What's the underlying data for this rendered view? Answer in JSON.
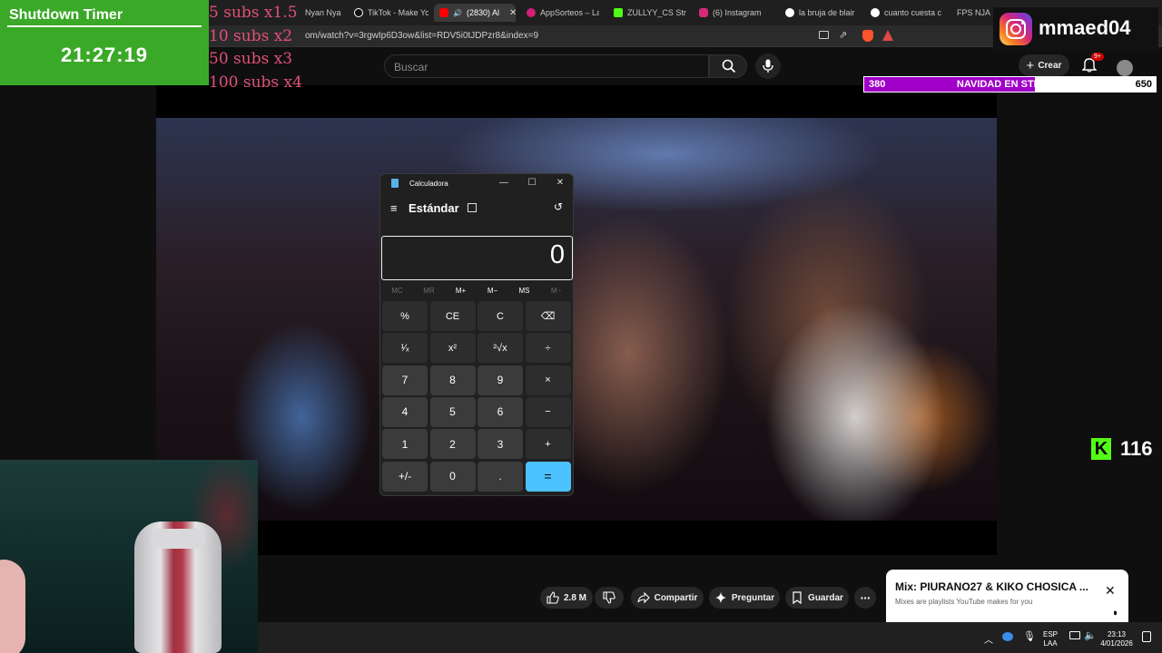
{
  "browser": {
    "tabs": [
      {
        "label": "Nyan Nya",
        "color": "#888888"
      },
      {
        "label": "TikTok - Make Yo",
        "color": "#ffffff"
      },
      {
        "label": "(2830) Al",
        "color": "#ff0000"
      },
      {
        "label": "AppSorteos – La",
        "color": "#d0207a"
      },
      {
        "label": "ZULLYY_CS Strea",
        "color": "#53fc18"
      },
      {
        "label": "(6) Instagram",
        "color": "#d62976"
      },
      {
        "label": "la bruja de blair",
        "color": "#dddddd"
      },
      {
        "label": "cuanto cuesta cr",
        "color": "#dddddd"
      },
      {
        "label": "FPS NJA",
        "color": "#dddddd"
      }
    ],
    "url": "om/watch?v=3rgwIp6D3ow&list=RDV5i0tJDPzr8&index=9"
  },
  "youtube": {
    "search_placeholder": "Buscar",
    "create_label": "Crear",
    "notif_badge": "9+",
    "actions": {
      "likes": "2.8 M",
      "share": "Compartir",
      "ask": "Preguntar",
      "save": "Guardar"
    },
    "mix": {
      "title": "Mix: PIURANO27 & KIKO CHOSICA ...",
      "subtitle": "Mixes are playlists YouTube makes for you"
    }
  },
  "overlay": {
    "timer_title": "Shutdown Timer",
    "timer_value": "21:27:19",
    "subs": [
      "5 subs x1.5",
      "10 subs x2",
      "50 subs x3",
      "100 subs x4"
    ],
    "instagram_handle": "mmaed04",
    "goal": {
      "current": "380",
      "label": "NAVIDAD EN STREAM",
      "target": "650",
      "progress": 0.585
    },
    "kick_viewers": "116"
  },
  "calculator": {
    "title": "Calculadora",
    "mode": "Estándar",
    "display": "0",
    "memory": [
      {
        "label": "MC",
        "enabled": false
      },
      {
        "label": "MR",
        "enabled": false
      },
      {
        "label": "M+",
        "enabled": true
      },
      {
        "label": "M−",
        "enabled": true
      },
      {
        "label": "MS",
        "enabled": true
      },
      {
        "label": "M~",
        "enabled": false
      }
    ],
    "keys": [
      [
        "%",
        "CE",
        "C",
        "⌫"
      ],
      [
        "¹⁄ₓ",
        "x²",
        "²√x",
        "÷"
      ],
      [
        "7",
        "8",
        "9",
        "×"
      ],
      [
        "4",
        "5",
        "6",
        "−"
      ],
      [
        "1",
        "2",
        "3",
        "+"
      ],
      [
        "+/-",
        "0",
        ".",
        "="
      ]
    ]
  },
  "taskbar": {
    "lang_top": "ESP",
    "lang_bottom": "LAA",
    "time": "23:13",
    "date": "4/01/2026"
  },
  "colors": {
    "timer_bg": "#3ba928",
    "goal_fill": "#a000c8",
    "calc_equals": "#4cc2ff",
    "kick_green": "#53fc18",
    "subs_text": "#e0507a"
  }
}
